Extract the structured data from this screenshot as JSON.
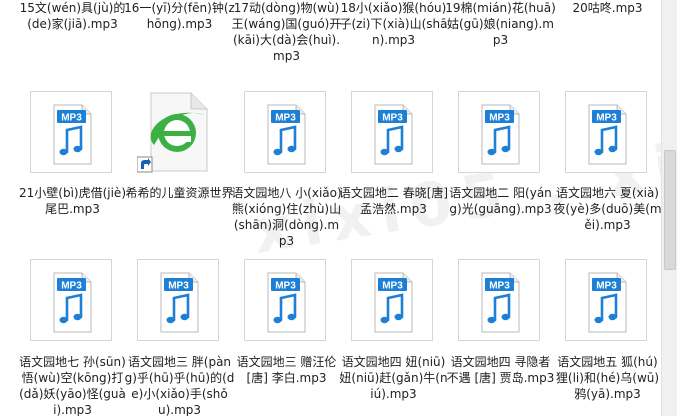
{
  "items": [
    {
      "label": "15文(wén)具(jù)的(de)家(jiā).mp3",
      "type": "mp3"
    },
    {
      "label": "16一(yī)分(fēn)钟(zhōng).mp3",
      "type": "mp3"
    },
    {
      "label": "17动(dòng)物(wù)王(wáng)国(guó)开(kāi)大(dà)会(huì).mp3",
      "type": "mp3"
    },
    {
      "label": "18小(xiǎo)猴(hóu)子(zi)下(xià)山(shān).mp3",
      "type": "mp3"
    },
    {
      "label": "19棉(mián)花(huā)姑(gū)娘(niang).mp3",
      "type": "mp3"
    },
    {
      "label": "20咕咚.mp3",
      "type": "mp3"
    },
    {
      "label": "21小壁(bì)虎借(jiè)尾巴.mp3",
      "type": "mp3"
    },
    {
      "label": "希希的儿童资源世界",
      "type": "ie-shortcut"
    },
    {
      "label": "语文园地八 小(xiǎo)熊(xióng)住(zhù)山(shān)洞(dòng).mp3",
      "type": "mp3"
    },
    {
      "label": "语文园地二 春晓[唐]孟浩然.mp3",
      "type": "mp3"
    },
    {
      "label": "语文园地二 阳(yáng)光(guāng).mp3",
      "type": "mp3"
    },
    {
      "label": "语文园地六 夏(xià)夜(yè)多(duō)美(měi).mp3",
      "type": "mp3"
    },
    {
      "label": "语文园地七 孙(sūn)悟(wù)空(kōng)打(dǎ)妖(yāo)怪(guài).mp3",
      "type": "mp3"
    },
    {
      "label": "语文园地三 胖(pàng)乎(hū)乎(hū)的(de)小(xiǎo)手(shǒu).mp3",
      "type": "mp3"
    },
    {
      "label": "语文园地三 赠汪伦[唐] 李白.mp3",
      "type": "mp3"
    },
    {
      "label": "语文园地四 妞(niū)妞(niū)赶(gǎn)牛(niú).mp3",
      "type": "mp3"
    },
    {
      "label": "语文园地四 寻隐者不遇 [唐] 贾岛.mp3",
      "type": "mp3"
    },
    {
      "label": "语文园地五 狐(hú)狸(li)和(hé)乌(wū)鸦(yā).mp3",
      "type": "mp3"
    }
  ],
  "icon_text": "MP3",
  "colors": {
    "mp3_blue": "#1e7fd6",
    "ie_green": "#3cb045",
    "accent": "#1e7fd6"
  }
}
